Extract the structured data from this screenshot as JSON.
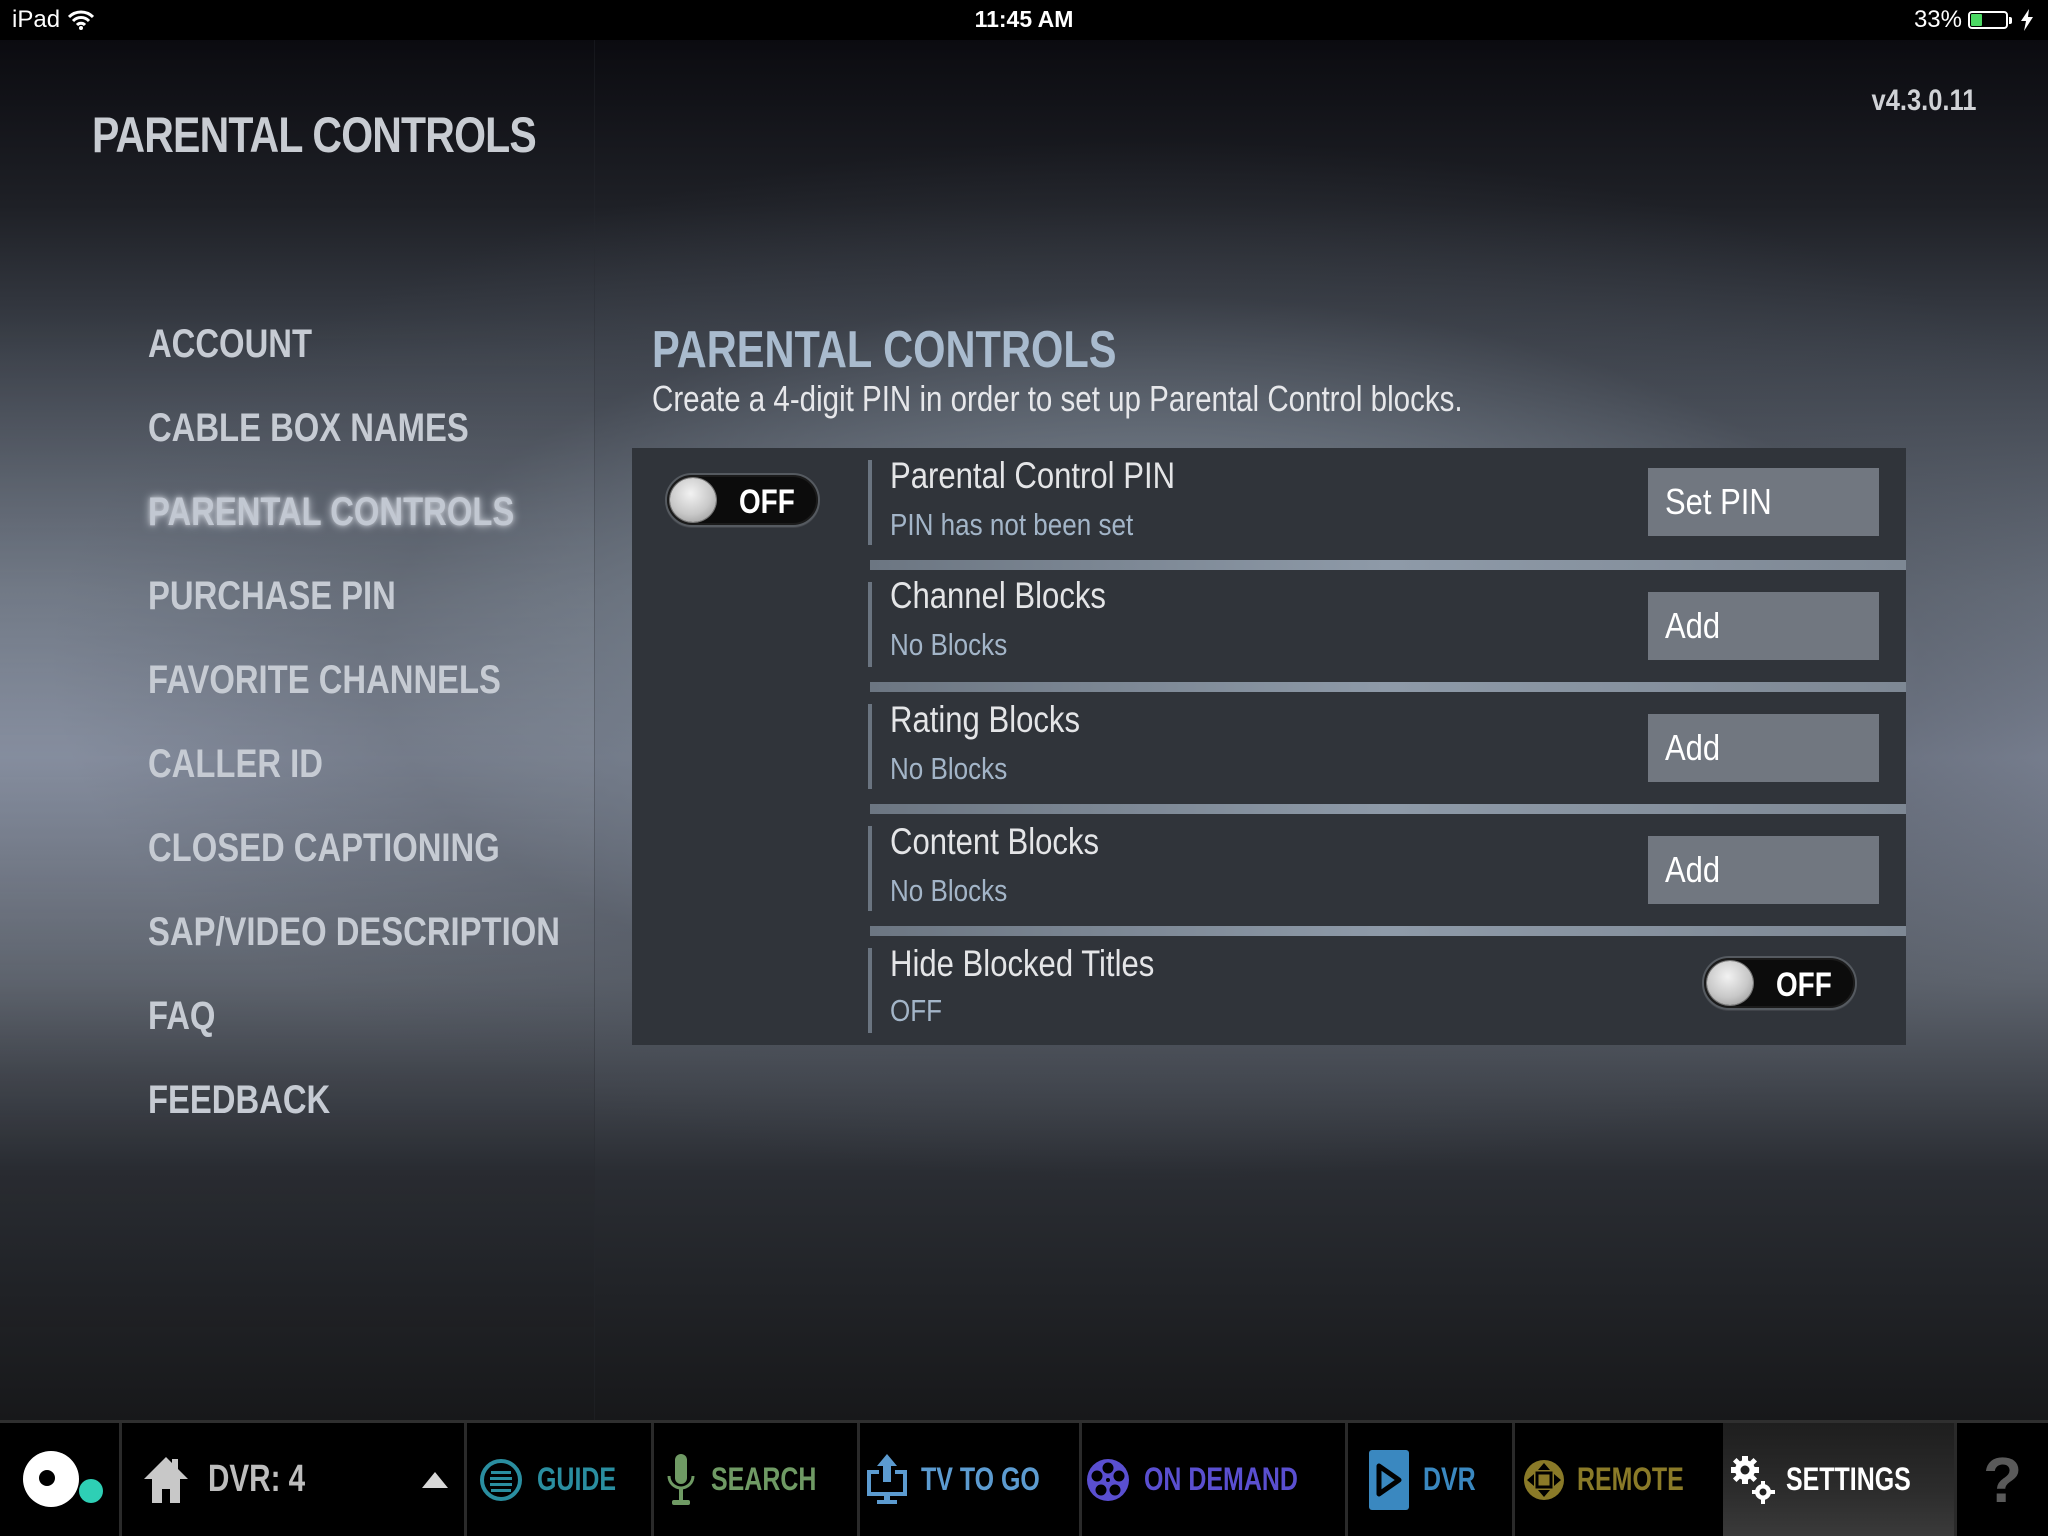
{
  "status_bar": {
    "device": "iPad",
    "wifi_icon": "wifi-icon",
    "time": "11:45 AM",
    "battery_percent": "33%",
    "battery_level": 0.33,
    "charging_icon": "bolt-icon"
  },
  "header": {
    "title": "PARENTAL CONTROLS",
    "version": "v4.3.0.11"
  },
  "sidebar": {
    "active_index": 2,
    "items": [
      {
        "label": "ACCOUNT"
      },
      {
        "label": "CABLE BOX NAMES"
      },
      {
        "label": "PARENTAL CONTROLS"
      },
      {
        "label": "PURCHASE PIN"
      },
      {
        "label": "FAVORITE CHANNELS"
      },
      {
        "label": "CALLER ID"
      },
      {
        "label": "CLOSED CAPTIONING"
      },
      {
        "label": "SAP/VIDEO DESCRIPTION"
      },
      {
        "label": "FAQ"
      },
      {
        "label": "FEEDBACK"
      }
    ]
  },
  "content": {
    "title": "PARENTAL CONTROLS",
    "subtitle": "Create a 4-digit PIN in order to set up Parental Control blocks.",
    "master_toggle": {
      "state": "OFF"
    },
    "rows": [
      {
        "title": "Parental Control PIN",
        "status": "PIN has not been set",
        "action": "Set PIN"
      },
      {
        "title": "Channel Blocks",
        "status": "No Blocks",
        "action": "Add"
      },
      {
        "title": "Rating Blocks",
        "status": "No Blocks",
        "action": "Add"
      },
      {
        "title": "Content Blocks",
        "status": "No Blocks",
        "action": "Add"
      },
      {
        "title": "Hide Blocked Titles",
        "status": "OFF",
        "toggle": "OFF"
      }
    ]
  },
  "tabbar": {
    "logo_icon": "app-logo-icon",
    "dvr_selector": {
      "label": "DVR: 4",
      "icon": "home-icon",
      "arrow": "caret-up-icon"
    },
    "tabs": [
      {
        "label": "GUIDE",
        "icon": "guide-icon",
        "color": "#2a8ea0"
      },
      {
        "label": "SEARCH",
        "icon": "microphone-icon",
        "color": "#6f9a64"
      },
      {
        "label": "TV TO GO",
        "icon": "upload-tv-icon",
        "color": "#5c9bd0"
      },
      {
        "label": "ON DEMAND",
        "icon": "film-reel-icon",
        "color": "#5a4fd0"
      },
      {
        "label": "DVR",
        "icon": "play-icon",
        "color": "#3a88c0"
      },
      {
        "label": "REMOTE",
        "icon": "dpad-icon",
        "color": "#8a7a28"
      },
      {
        "label": "SETTINGS",
        "icon": "gears-icon",
        "color": "#ffffff",
        "active": true
      }
    ],
    "help_icon": "help-icon",
    "help_glyph": "?"
  },
  "colors": {
    "accent_title": "#a9bbce",
    "status_text": "#a3b5c8",
    "panel_bg": "#30343a",
    "button_bg": "#717780",
    "logo_dot": "#2ecfb5"
  }
}
